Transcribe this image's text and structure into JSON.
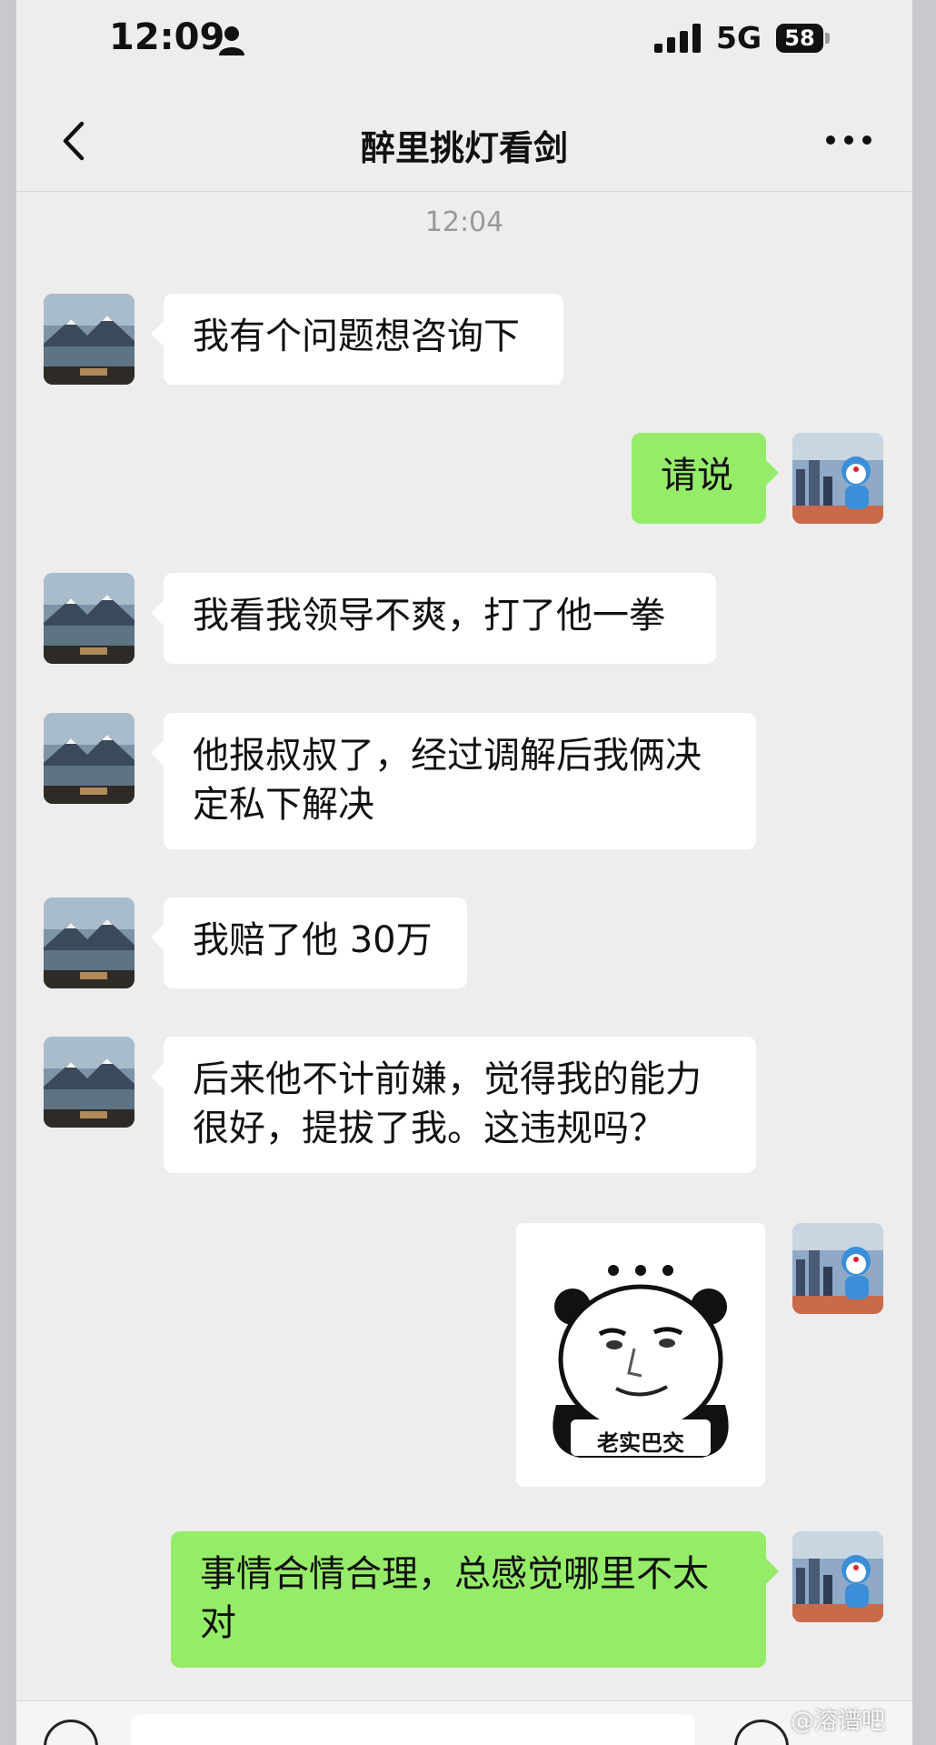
{
  "status_bar": {
    "time": "12:09",
    "network": "5G",
    "battery": "58"
  },
  "header": {
    "title": "醉里挑灯看剑"
  },
  "chat": {
    "timestamp": "12:04",
    "messages": [
      {
        "side": "left",
        "text": "我有个问题想咨询下"
      },
      {
        "side": "right",
        "text": "请说"
      },
      {
        "side": "left",
        "text": "我看我领导不爽，打了他一拳"
      },
      {
        "side": "left",
        "text": "他报叔叔了，经过调解后我俩决定私下解决"
      },
      {
        "side": "left",
        "text": "我赔了他 30万"
      },
      {
        "side": "left",
        "text": "后来他不计前嫌，觉得我的能力很好，提拔了我。这违规吗？"
      },
      {
        "side": "right",
        "type": "sticker",
        "caption": "老实巴交"
      },
      {
        "side": "right",
        "text": "事情合情合理，总感觉哪里不太对"
      }
    ]
  },
  "watermark": "@溶谱吧",
  "icons": {
    "back": "chevron-left-icon",
    "more": "more-dots-icon",
    "person": "person-icon",
    "signal": "signal-bars-icon"
  }
}
